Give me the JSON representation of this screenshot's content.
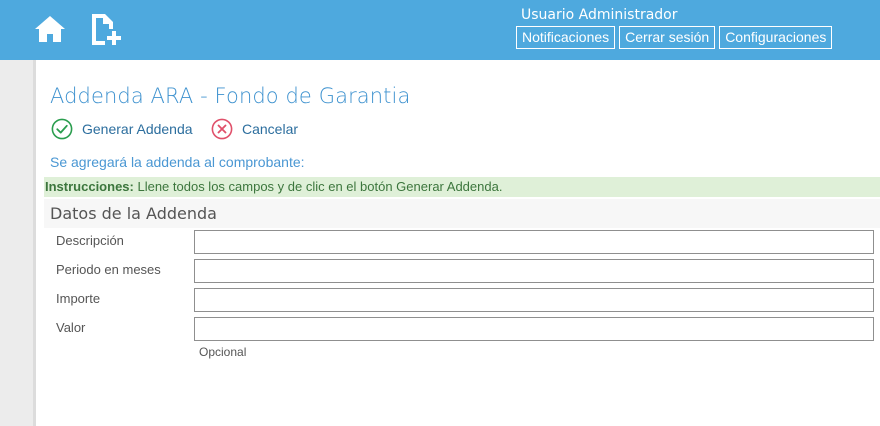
{
  "header": {
    "username": "Usuario Administrador",
    "links": {
      "notifications": "Notificaciones",
      "logout": "Cerrar sesión",
      "settings": "Configuraciones"
    },
    "icons": [
      "home-icon",
      "new-document-icon"
    ]
  },
  "page": {
    "title": "Addenda ARA - Fondo de Garantia",
    "actions": {
      "generate": "Generar Addenda",
      "cancel": "Cancelar"
    },
    "subtitle": "Se agregará la addenda al comprobante:",
    "instructions_label": "Instrucciones:",
    "instructions_text": " Llene todos los campos y de clic en el botón Generar Addenda.",
    "section_title": "Datos de la Addenda"
  },
  "form": {
    "descripcion": {
      "label": "Descripción",
      "value": ""
    },
    "periodo": {
      "label": "Periodo en meses",
      "value": ""
    },
    "importe": {
      "label": "Importe",
      "value": ""
    },
    "valor": {
      "label": "Valor",
      "value": "",
      "hint": "Opcional"
    }
  },
  "colors": {
    "topbar": "#4ea9de",
    "title": "#3e92cf",
    "instructions_bg": "#dff0d8",
    "instructions_text": "#3c763d",
    "generate_icon": "#2a9d4e",
    "cancel_icon": "#e0506a"
  }
}
